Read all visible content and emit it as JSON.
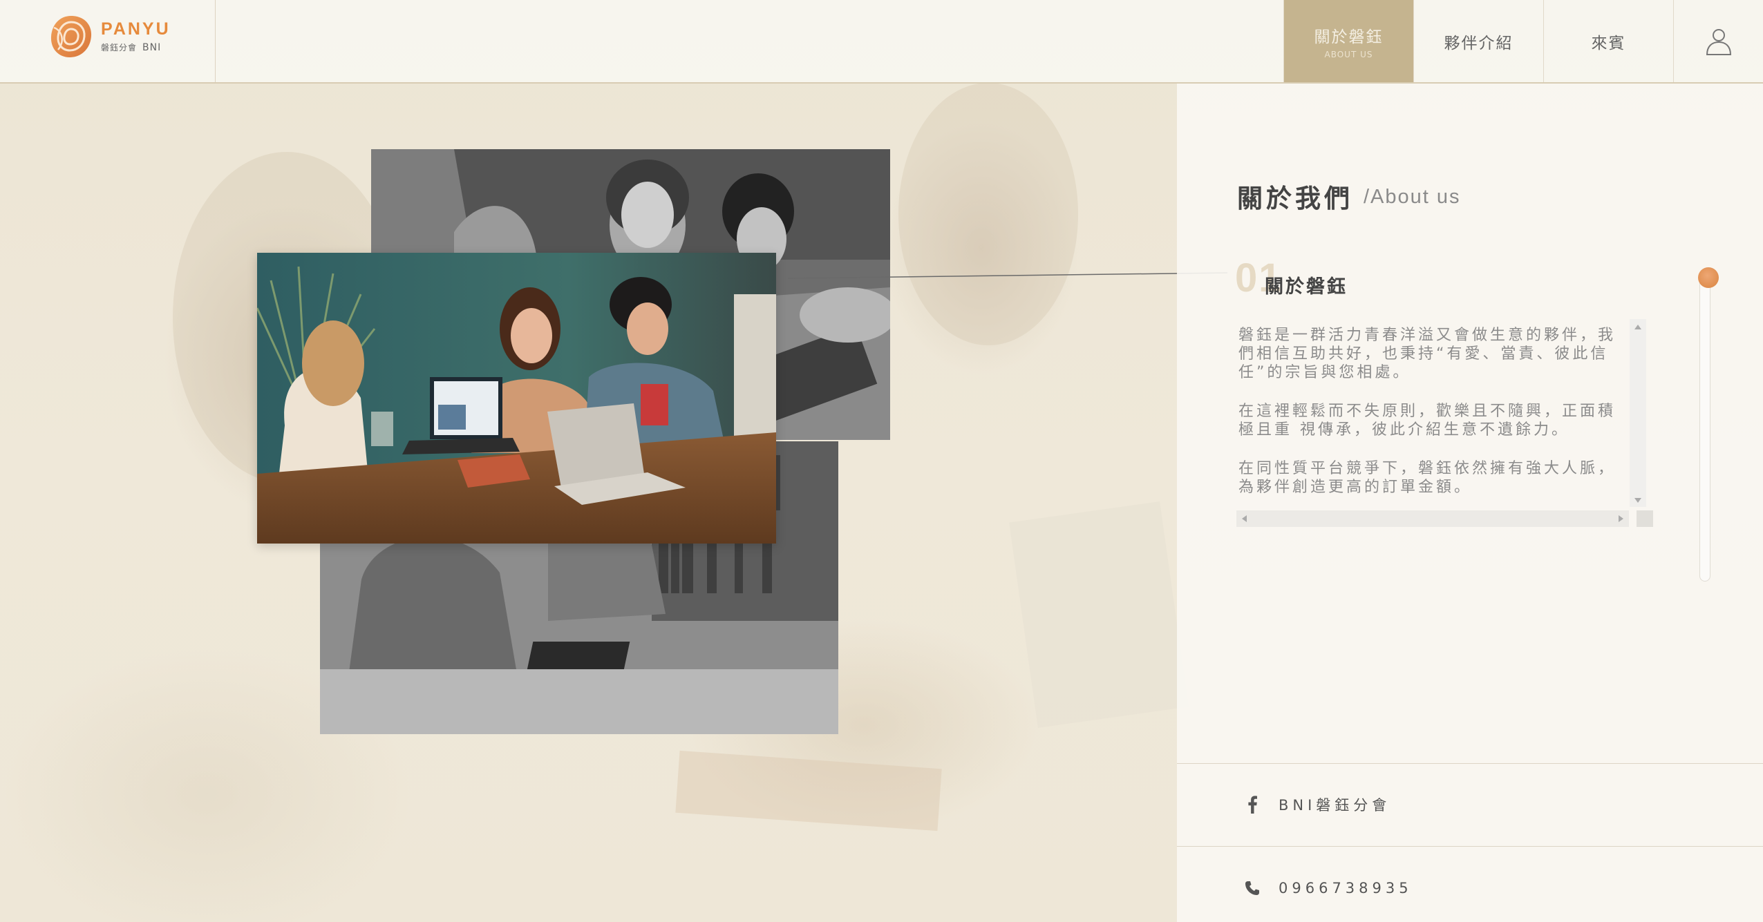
{
  "logo": {
    "name": "PANYU",
    "subtitle": "磐鈺分會",
    "bni": "BNI",
    "brand_color": "#e68a3c"
  },
  "nav": {
    "items": [
      {
        "label": "關於磐鈺",
        "sublabel": "ABOUT US",
        "active": true
      },
      {
        "label": "夥伴介紹",
        "active": false
      },
      {
        "label": "來賓",
        "active": false
      }
    ],
    "user_icon": "user-icon",
    "active_color": "#c5b48f"
  },
  "about": {
    "title": "關於我們",
    "subtitle": "/About us",
    "item_number": "01",
    "item_title": "關於磐鈺",
    "paragraphs": [
      "磐鈺是一群活力青春洋溢又會做生意的夥伴，我們相信互助共好，也秉持“有愛、當責、彼此信任”的宗旨與您相處。",
      "在這裡輕鬆而不失原則，歡樂且不隨興，正面積極且重 視傳承，彼此介紹生意不遺餘力。",
      "在同性質平台競爭下，磐鈺依然擁有強大人脈，為夥伴創造更高的訂單金額。"
    ]
  },
  "contacts": {
    "facebook": {
      "icon": "facebook-icon",
      "label": "BNI磐鈺分會"
    },
    "phone": {
      "icon": "phone-icon",
      "label": "0966738935"
    }
  }
}
